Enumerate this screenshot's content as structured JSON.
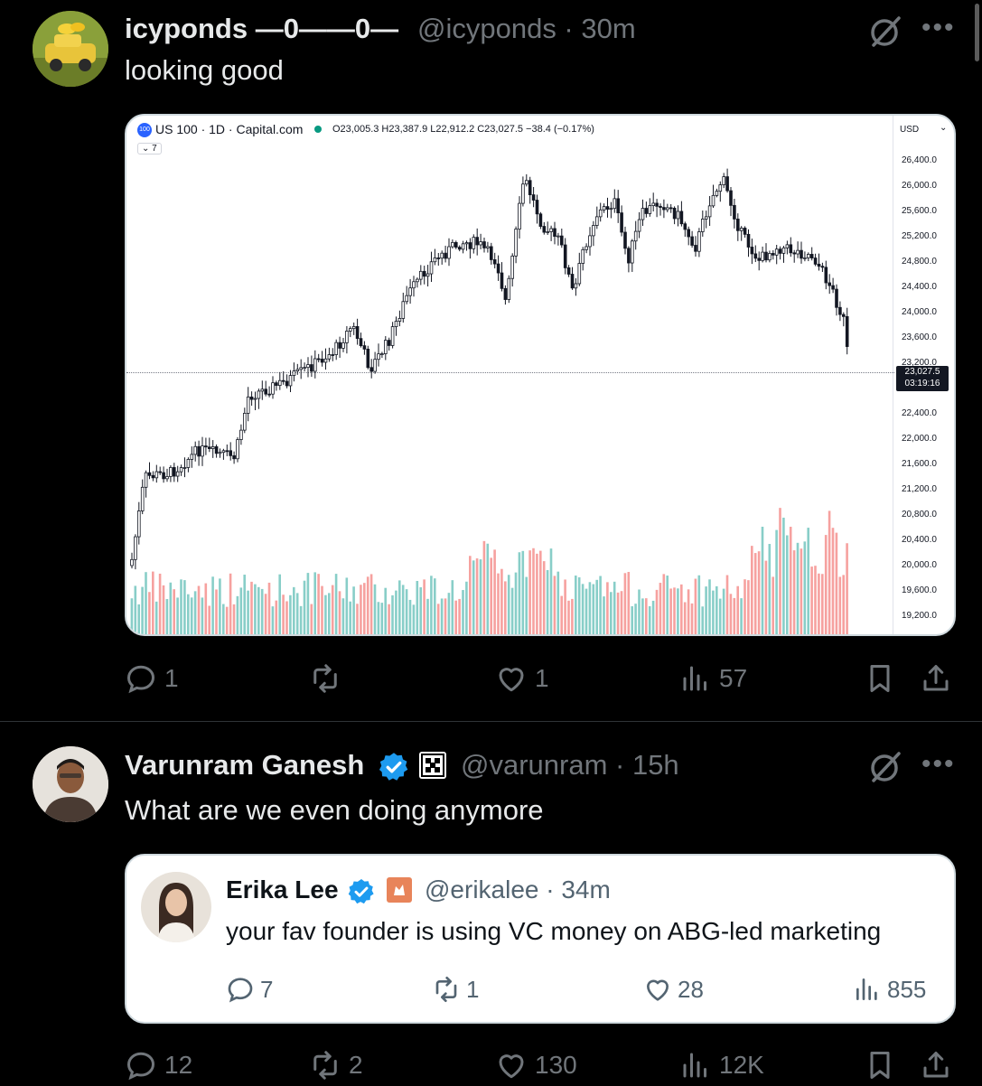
{
  "post1": {
    "display_name": "icyponds —0——0—",
    "handle": "@icyponds · 30m",
    "text": "looking good",
    "chart": {
      "symbol": "US 100 · 1D · Capital.com",
      "ohlc": "O23,005.3 H23,387.9 L22,912.2 C23,027.5 −38.4 (−0.17%)",
      "badge": "100",
      "indicator_count": "7",
      "currency": "USD",
      "y_ticks": [
        "26,400.0",
        "26,000.0",
        "25,600.0",
        "25,200.0",
        "24,800.0",
        "24,400.0",
        "24,000.0",
        "23,600.0",
        "23,200.0",
        "22,400.0",
        "22,000.0",
        "21,600.0",
        "21,200.0",
        "20,800.0",
        "20,400.0",
        "20,000.0",
        "19,600.0",
        "19,200.0"
      ],
      "last_price": "23,027.5",
      "countdown": "03:19:16",
      "up_color": "#26a69a",
      "down_color": "#ef5350"
    },
    "actions": {
      "replies": "1",
      "reposts": "",
      "likes": "1",
      "views": "57"
    }
  },
  "post2": {
    "display_name": "Varunram Ganesh",
    "handle": "@varunram · 15h",
    "text": "What are we even doing anymore",
    "quote": {
      "display_name": "Erika Lee",
      "handle": "@erikalee · 34m",
      "text": "your fav founder is using VC money on ABG-led marketing",
      "actions": {
        "replies": "7",
        "reposts": "1",
        "likes": "28",
        "views": "855"
      }
    },
    "actions": {
      "replies": "12",
      "reposts": "2",
      "likes": "130",
      "views": "12K"
    }
  },
  "colors": {
    "accent": "#1d9bf0",
    "muted": "#71767b",
    "background": "#000000"
  },
  "icons": [
    "reply-icon",
    "repost-icon",
    "like-icon",
    "views-icon",
    "bookmark-icon",
    "share-icon",
    "grok-icon",
    "more-icon",
    "verified-icon"
  ]
}
